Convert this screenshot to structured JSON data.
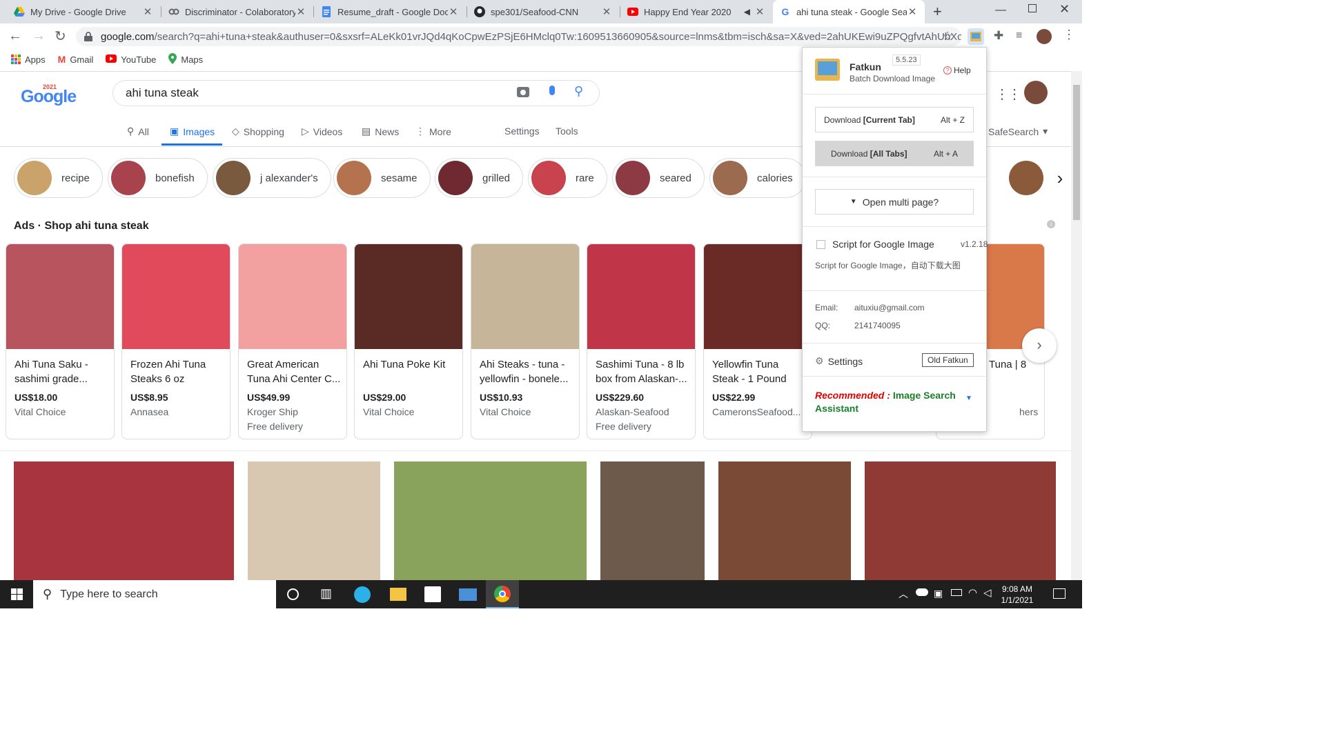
{
  "browser": {
    "tabs": [
      {
        "title": "My Drive - Google Drive",
        "icon": "google-drive-icon"
      },
      {
        "title": "Discriminator - Colaboratory",
        "icon": "colab-icon"
      },
      {
        "title": "Resume_draft - Google Docs",
        "icon": "google-docs-icon"
      },
      {
        "title": "spe301/Seafood-CNN",
        "icon": "github-icon"
      },
      {
        "title": "Happy End Year 2020",
        "icon": "youtube-icon"
      },
      {
        "title": "ahi tuna steak - Google Search",
        "icon": "google-icon"
      }
    ],
    "new_tab_glyph": "+",
    "url_domain": "google.com",
    "url_rest": "/search?q=ahi+tuna+steak&authuser=0&sxsrf=ALeKk01vrJQd4qKoCpwEzPSjE6HMclq0Tw:1609513660905&source=lnms&tbm=isch&sa=X&ved=2ahUKEwi9uZPQgfvtAhUbXc0K...",
    "bookmarks": [
      {
        "label": "Apps",
        "icon": "apps-grid-icon"
      },
      {
        "label": "Gmail",
        "icon": "gmail-icon"
      },
      {
        "label": "YouTube",
        "icon": "youtube-icon"
      },
      {
        "label": "Maps",
        "icon": "maps-icon"
      }
    ]
  },
  "search": {
    "logo_text": "Google",
    "logo_year": "2021",
    "query": "ahi tuna steak",
    "nav": [
      {
        "label": "All",
        "icon": "search-icon"
      },
      {
        "label": "Images",
        "icon": "image-icon"
      },
      {
        "label": "Shopping",
        "icon": "tag-icon"
      },
      {
        "label": "Videos",
        "icon": "play-icon"
      },
      {
        "label": "News",
        "icon": "news-icon"
      },
      {
        "label": "More",
        "icon": "more-vert-icon"
      }
    ],
    "settings_label": "Settings",
    "tools_label": "Tools",
    "safesearch_label": "SafeSearch"
  },
  "chips": [
    {
      "label": "recipe",
      "color": "#c9a36a"
    },
    {
      "label": "bonefish",
      "color": "#a8424c"
    },
    {
      "label": "j alexander's",
      "color": "#7a5a3e"
    },
    {
      "label": "sesame",
      "color": "#b5724e"
    },
    {
      "label": "grilled",
      "color": "#6e2a30"
    },
    {
      "label": "rare",
      "color": "#c9434e"
    },
    {
      "label": "seared",
      "color": "#8e3a44"
    },
    {
      "label": "calories",
      "color": "#9c6b4f"
    }
  ],
  "ads": {
    "heading": "Ads · Shop ahi tuna steak",
    "products": [
      {
        "title": "Ahi Tuna Saku - sashimi grade...",
        "price": "US$18.00",
        "store": "Vital Choice",
        "delivery": "",
        "color": "#b8545e"
      },
      {
        "title": "Frozen Ahi Tuna Steaks 6 oz",
        "price": "US$8.95",
        "store": "Annasea",
        "delivery": "",
        "color": "#e04a5a"
      },
      {
        "title": "Great American Tuna Ahi Center C...",
        "price": "US$49.99",
        "store": "Kroger Ship",
        "delivery": "Free delivery",
        "color": "#f2a0a0"
      },
      {
        "title": "Ahi Tuna Poke Kit",
        "price": "US$29.00",
        "store": "Vital Choice",
        "delivery": "",
        "color": "#5a2a24"
      },
      {
        "title": "Ahi Steaks - tuna - yellowfin - bonele...",
        "price": "US$10.93",
        "store": "Vital Choice",
        "delivery": "",
        "color": "#c7b59a"
      },
      {
        "title": "Sashimi Tuna - 8 lb box from Alaskan-...",
        "price": "US$229.60",
        "store": "Alaskan-Seafood",
        "delivery": "Free delivery",
        "color": "#c03548"
      },
      {
        "title": "Yellowfin Tuna Steak - 1 Pound",
        "price": "US$22.99",
        "store": "CameronsSeafood...",
        "delivery": "",
        "color": "#6a2a26"
      },
      {
        "title": "Tuna | 8",
        "price": "",
        "store": "hers",
        "delivery": "",
        "color": "#d9794a"
      }
    ]
  },
  "results_images": [
    {
      "color": "#a8343f"
    },
    {
      "color": "#d8c8b2"
    },
    {
      "color": "#8aa35c"
    },
    {
      "color": "#6d5a4a"
    },
    {
      "color": "#7a4a36"
    },
    {
      "color": "#8f3a34"
    }
  ],
  "fatkun": {
    "name": "Fatkun",
    "version": "5.5.23",
    "subtitle": "Batch Download Image",
    "help": "Help",
    "download_current": "Download",
    "download_current_tag": "[Current Tab]",
    "download_current_key": "Alt + Z",
    "download_all": "Download",
    "download_all_tag": "[All Tabs]",
    "download_all_key": "Alt + A",
    "open_multi": "Open multi page?",
    "script_title": "Script for Google Image",
    "script_version": "v1.2.18",
    "script_desc": "Script for Google Image，自动下载大图",
    "email_label": "Email:",
    "email_value": "aituxiu@gmail.com",
    "qq_label": "QQ:",
    "qq_value": "2141740095",
    "settings": "Settings",
    "old_fatkun": "Old Fatkun",
    "recommended_prefix": "Recommended : ",
    "recommended_link": "Image Search Assistant"
  },
  "taskbar": {
    "search_placeholder": "Type here to search",
    "time": "9:08 AM",
    "date": "1/1/2021"
  }
}
